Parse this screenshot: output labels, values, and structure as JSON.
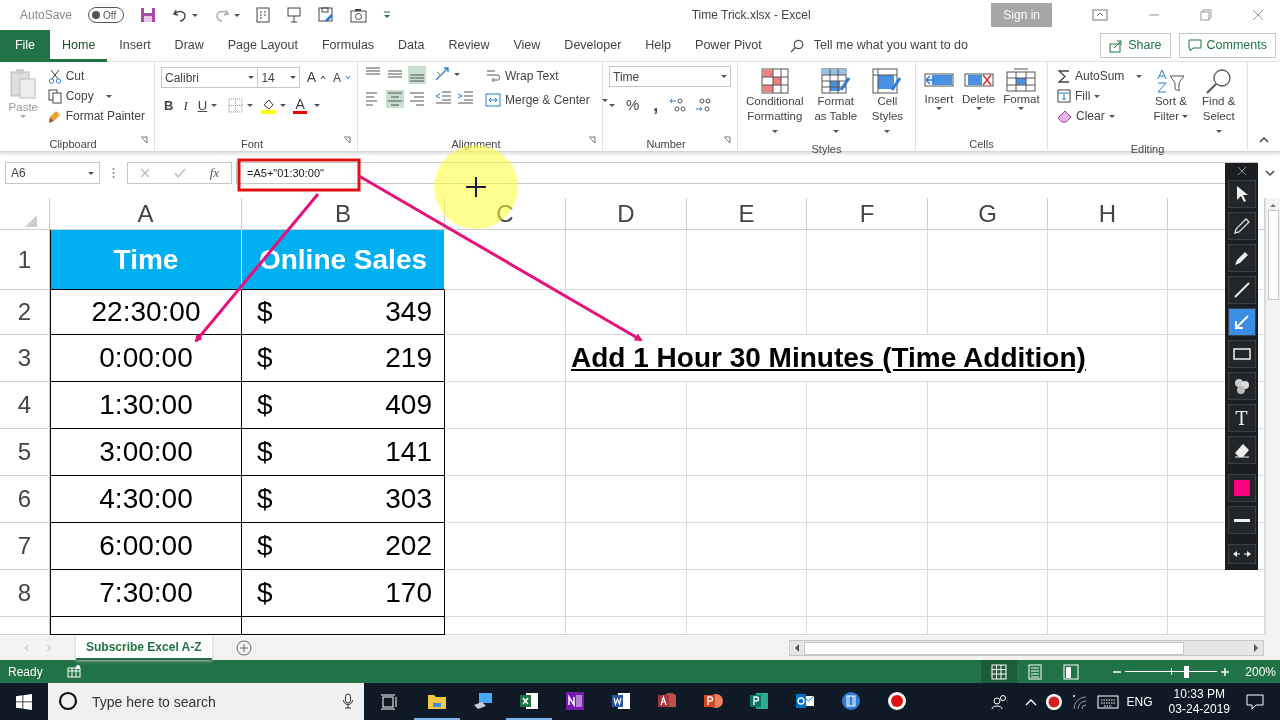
{
  "title_bar": {
    "autosave": "AutoSave",
    "autosave_state": "Off",
    "autosave_on": false,
    "title": "Time Trick.xlsx - Excel",
    "sign_in": "Sign in"
  },
  "ribbon_tabs": [
    {
      "label": "File",
      "kind": "file",
      "selected": false
    },
    {
      "label": "Home",
      "kind": "tab",
      "selected": true
    },
    {
      "label": "Insert",
      "kind": "tab",
      "selected": false
    },
    {
      "label": "Draw",
      "kind": "tab",
      "selected": false
    },
    {
      "label": "Page Layout",
      "kind": "tab",
      "selected": false
    },
    {
      "label": "Formulas",
      "kind": "tab",
      "selected": false
    },
    {
      "label": "Data",
      "kind": "tab",
      "selected": false
    },
    {
      "label": "Review",
      "kind": "tab",
      "selected": false
    },
    {
      "label": "View",
      "kind": "tab",
      "selected": false
    },
    {
      "label": "Developer",
      "kind": "tab",
      "selected": false
    },
    {
      "label": "Help",
      "kind": "tab",
      "selected": false
    },
    {
      "label": "Power Pivot",
      "kind": "tab",
      "selected": false
    }
  ],
  "tell_me": {
    "placeholder": "Tell me what you want to do"
  },
  "share": "Share",
  "comments": "Comments",
  "ribbon": {
    "clipboard": {
      "name": "Clipboard",
      "paste": "Paste",
      "cut": "Cut",
      "copy": "Copy",
      "format_painter": "Format Painter"
    },
    "font": {
      "name": "Font",
      "font_name": "Calibri",
      "font_size": "14",
      "grow": "A",
      "shrink": "A",
      "bold": "B",
      "italic": "I",
      "underline": "U",
      "font_color": "A"
    },
    "alignment": {
      "name": "Alignment",
      "wrap_text": "Wrap Text",
      "merge_center": "Merge & Center",
      "vertical_align": [
        {
          "kind": "top",
          "selected": false
        },
        {
          "kind": "middle",
          "selected": false
        },
        {
          "kind": "bottom",
          "selected": true
        }
      ],
      "horizontal_align": [
        {
          "kind": "left",
          "selected": false
        },
        {
          "kind": "center",
          "selected": true
        },
        {
          "kind": "right",
          "selected": false
        }
      ]
    },
    "number": {
      "name": "Number",
      "format": "Time",
      "percent": "%",
      "comma": ","
    },
    "styles": {
      "name": "Styles",
      "conditional": "Conditional Formatting",
      "format_table": "Format as Table",
      "cell_styles": "Cell Styles"
    },
    "cells": {
      "name": "Cells",
      "insert": "Insert",
      "delete": "Delete",
      "format": "Format"
    },
    "editing": {
      "name": "Editing",
      "autosum": "AutoSum",
      "fill": "Fill",
      "clear": "Clear",
      "sort_filter": "Sort & Filter",
      "find_select": "Find & Select"
    }
  },
  "formula_bar": {
    "name_box": "A6",
    "fx": "fx",
    "formula": "=A5+\"01:30:00\""
  },
  "sheet": {
    "columns": [
      "A",
      "B",
      "C",
      "D",
      "E",
      "F",
      "G",
      "H"
    ],
    "rows": [
      {
        "number": "1",
        "kind": "header",
        "cells": [
          "Time",
          "Online Sales"
        ]
      },
      {
        "number": "2",
        "kind": "data",
        "cells": [
          "22:30:00",
          "$",
          "349"
        ]
      },
      {
        "number": "3",
        "kind": "data",
        "cells": [
          "0:00:00",
          "$",
          "219"
        ]
      },
      {
        "number": "4",
        "kind": "data",
        "cells": [
          "1:30:00",
          "$",
          "409"
        ]
      },
      {
        "number": "5",
        "kind": "data",
        "cells": [
          "3:00:00",
          "$",
          "141"
        ]
      },
      {
        "number": "6",
        "kind": "data",
        "cells": [
          "4:30:00",
          "$",
          "303"
        ]
      },
      {
        "number": "7",
        "kind": "data",
        "cells": [
          "6:00:00",
          "$",
          "202"
        ]
      },
      {
        "number": "8",
        "kind": "data",
        "cells": [
          "7:30:00",
          "$",
          "170"
        ]
      }
    ],
    "note": "Add 1 Hour 30 Minutes (Time Addition)"
  },
  "sheet_tabs": [
    {
      "label": "Subscribe Excel A-Z",
      "selected": true
    }
  ],
  "status_bar": {
    "status": "Ready",
    "views": [
      {
        "kind": "normal",
        "selected": true
      },
      {
        "kind": "page_layout",
        "selected": false
      },
      {
        "kind": "page_break",
        "selected": false
      }
    ],
    "zoom": {
      "level": 0.66
    },
    "zoom_label": "200%"
  },
  "pen_toolbar": {
    "tools": [
      {
        "kind": "select",
        "selected": false
      },
      {
        "kind": "pencil",
        "selected": false
      },
      {
        "kind": "highlighter",
        "selected": false
      },
      {
        "kind": "line",
        "selected": false
      },
      {
        "kind": "arrow",
        "selected": true
      },
      {
        "kind": "rectangle",
        "selected": false
      },
      {
        "kind": "stamp",
        "selected": false
      },
      {
        "kind": "text",
        "label": "T",
        "selected": false
      },
      {
        "kind": "eraser",
        "selected": false
      }
    ],
    "color": "#ff0080"
  },
  "taskbar": {
    "search": {
      "placeholder": "Type here to search"
    },
    "apps": [
      {
        "kind": "folder",
        "running": true
      },
      {
        "kind": "computer",
        "running": false
      },
      {
        "kind": "excel",
        "running": true
      },
      {
        "kind": "onenote",
        "running": false
      },
      {
        "kind": "word",
        "running": false
      },
      {
        "kind": "access",
        "running": false
      },
      {
        "kind": "powerpoint",
        "running": false
      },
      {
        "kind": "publisher",
        "running": false
      },
      {
        "kind": "outlook",
        "running": false
      },
      {
        "kind": "film",
        "running": false
      },
      {
        "kind": "record",
        "running": false
      }
    ],
    "language": "ENG",
    "time": "10:33 PM",
    "date": "03-24-2019"
  }
}
